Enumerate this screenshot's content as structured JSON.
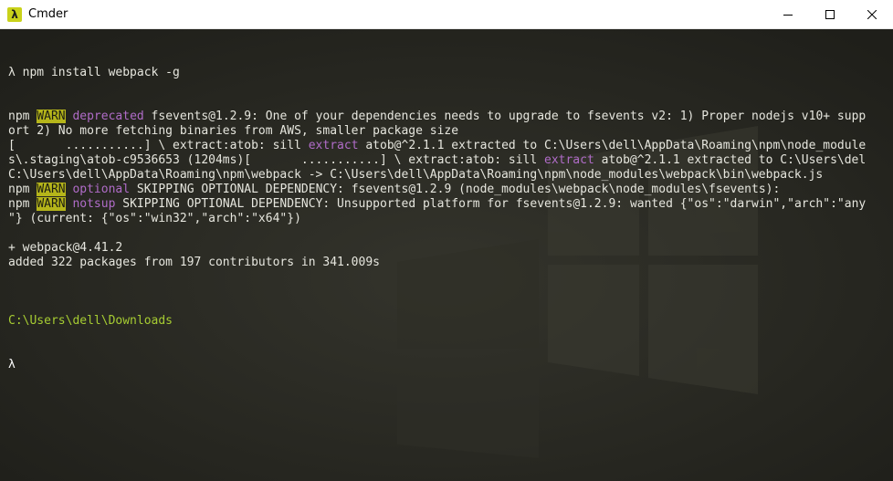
{
  "window": {
    "title": "Cmder",
    "app_icon_glyph": "λ",
    "controls": [
      "minimize-icon",
      "maximize-icon",
      "close-icon"
    ]
  },
  "colors": {
    "background": "#272822",
    "text": "#e6e6de",
    "warn_bg": "#b5b51a",
    "purple": "#b06cc8",
    "green": "#a6cc32"
  },
  "terminal": {
    "command_line": "λ npm install webpack -g",
    "lines": [
      {
        "type": "warn",
        "prefix": "npm ",
        "badge": "WARN",
        "tag": "deprecated",
        "rest": " fsevents@1.2.9: One of your dependencies needs to upgrade to fsevents v2: 1) Proper nodejs v10+ supp"
      },
      {
        "type": "plain",
        "text": "ort 2) No more fetching binaries from AWS, smaller package size"
      },
      {
        "type": "progress",
        "part1": "[       ...........] \\ extract:atob: sill ",
        "extract1": "extract",
        "part2": " atob@^2.1.1 extracted to C:\\Users\\dell\\AppData\\Roaming\\npm\\node_module"
      },
      {
        "type": "progress",
        "part1": "s\\.staging\\atob-c9536653 (1204ms)[       ...........] \\ extract:atob: sill ",
        "extract1": "extract",
        "part2": " atob@^2.1.1 extracted to C:\\Users\\del"
      },
      {
        "type": "plain",
        "text": "C:\\Users\\dell\\AppData\\Roaming\\npm\\webpack -> C:\\Users\\dell\\AppData\\Roaming\\npm\\node_modules\\webpack\\bin\\webpack.js"
      },
      {
        "type": "warn",
        "prefix": "npm ",
        "badge": "WARN",
        "tag": "optional",
        "rest": " SKIPPING OPTIONAL DEPENDENCY: fsevents@1.2.9 (node_modules\\webpack\\node_modules\\fsevents):"
      },
      {
        "type": "warn",
        "prefix": "npm ",
        "badge": "WARN",
        "tag": "notsup",
        "rest": " SKIPPING OPTIONAL DEPENDENCY: Unsupported platform for fsevents@1.2.9: wanted {\"os\":\"darwin\",\"arch\":\"any"
      },
      {
        "type": "plain",
        "text": "\"} (current: {\"os\":\"win32\",\"arch\":\"x64\"})"
      },
      {
        "type": "plain",
        "text": ""
      },
      {
        "type": "plain",
        "text": "+ webpack@4.41.2"
      },
      {
        "type": "plain",
        "text": "added 322 packages from 197 contributors in 341.009s"
      },
      {
        "type": "plain",
        "text": ""
      }
    ],
    "cwd": "C:\\Users\\dell\\Downloads",
    "prompt": "λ"
  }
}
